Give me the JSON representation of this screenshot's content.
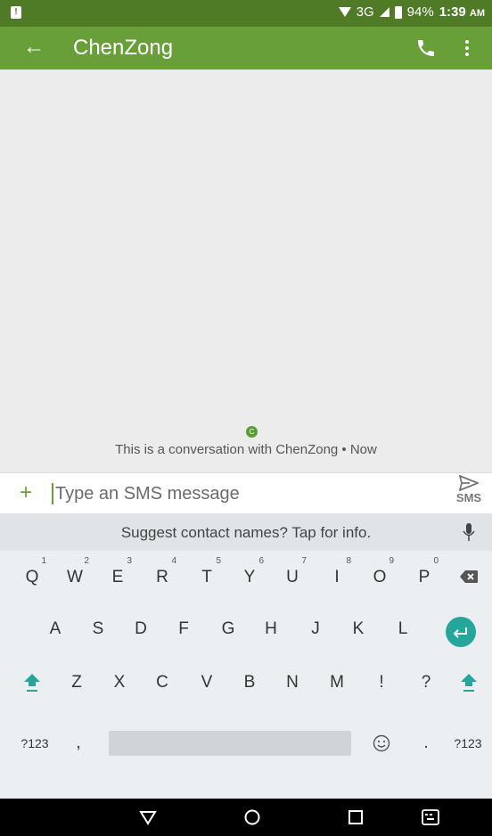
{
  "status_bar": {
    "network": "3G",
    "battery": "94%",
    "time": "1:39",
    "ampm": "AM"
  },
  "app_bar": {
    "title": "ChenZong"
  },
  "conversation": {
    "avatar_letter": "C",
    "info_text": "This is a conversation with ChenZong • Now"
  },
  "compose": {
    "placeholder": "Type an SMS message",
    "send_label": "SMS"
  },
  "keyboard": {
    "suggestion": "Suggest contact names? Tap for info.",
    "row1": [
      {
        "key": "Q",
        "hint": "1"
      },
      {
        "key": "W",
        "hint": "2"
      },
      {
        "key": "E",
        "hint": "3"
      },
      {
        "key": "R",
        "hint": "4"
      },
      {
        "key": "T",
        "hint": "5"
      },
      {
        "key": "Y",
        "hint": "6"
      },
      {
        "key": "U",
        "hint": "7"
      },
      {
        "key": "I",
        "hint": "8"
      },
      {
        "key": "O",
        "hint": "9"
      },
      {
        "key": "P",
        "hint": "0"
      }
    ],
    "row2": [
      "A",
      "S",
      "D",
      "F",
      "G",
      "H",
      "J",
      "K",
      "L"
    ],
    "row3": [
      "Z",
      "X",
      "C",
      "V",
      "B",
      "N",
      "M",
      "!",
      "?"
    ],
    "symbols_label": "?123",
    "comma": ",",
    "period": ".",
    "symbols_label_right": "?123",
    "accent_color": "#26a69a"
  },
  "colors": {
    "status_bar": "#4f7a26",
    "app_bar": "#689f38"
  }
}
